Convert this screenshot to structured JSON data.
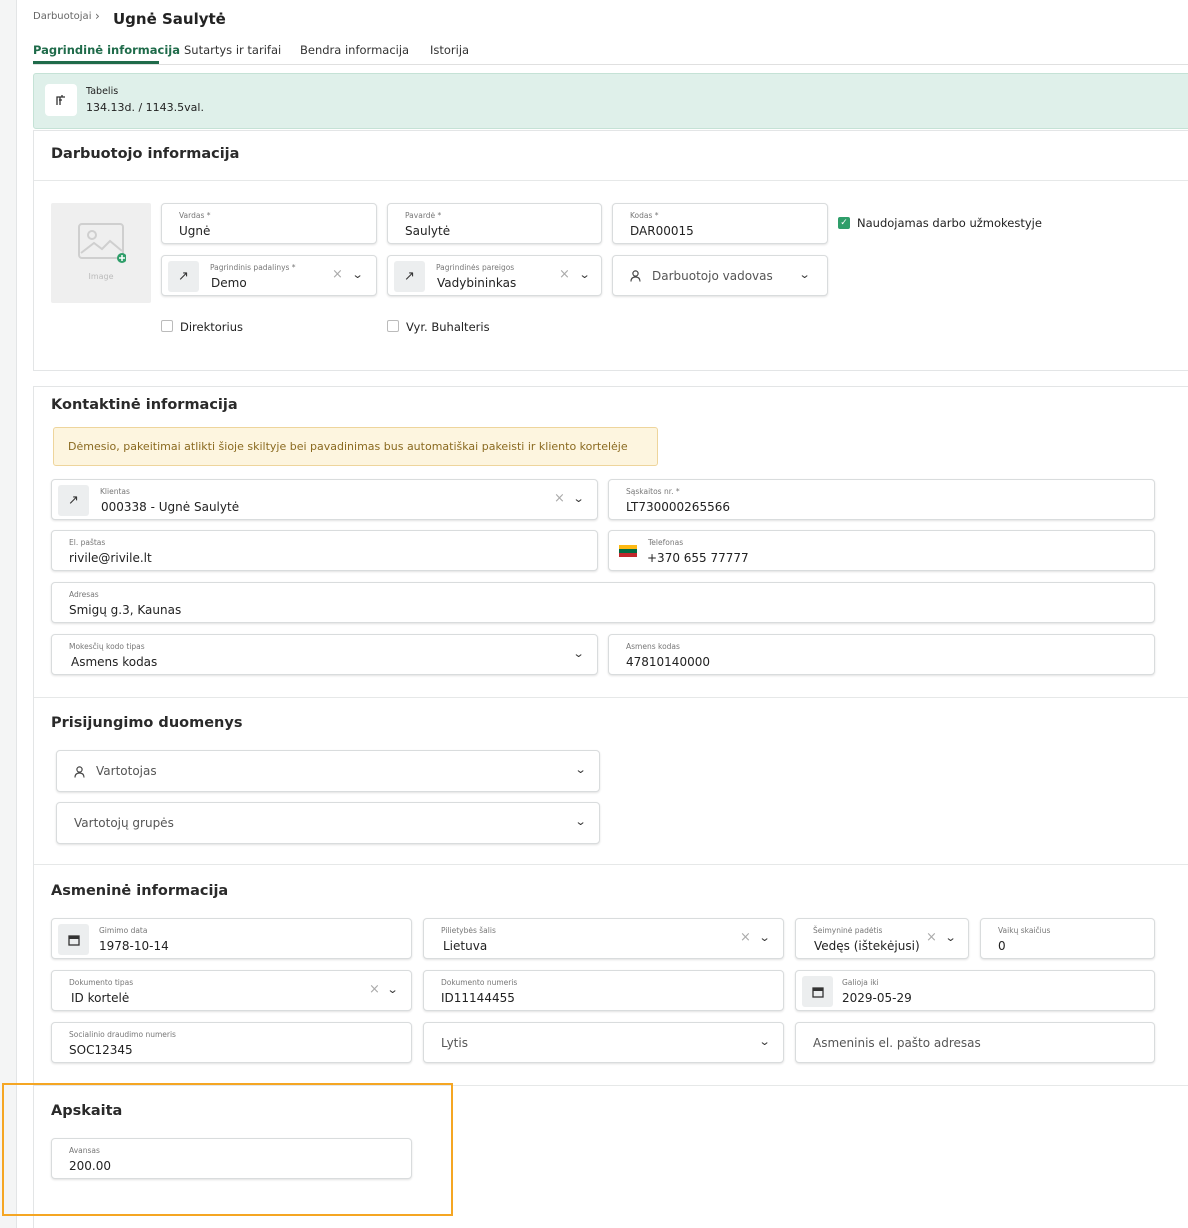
{
  "breadcrumb": {
    "root": "Darbuotojai",
    "current": "Ugnė Saulytė"
  },
  "tabs": [
    {
      "label": "Pagrindinė informacija",
      "active": true
    },
    {
      "label": "Sutartys ir tarifai"
    },
    {
      "label": "Bendra informacija"
    },
    {
      "label": "Istorija"
    }
  ],
  "tabelis": {
    "title": "Tabelis",
    "value": "134.13d. / 1143.5val."
  },
  "employee": {
    "title": "Darbuotojo informacija",
    "image_label": "Image",
    "vardas": {
      "label": "Vardas *",
      "value": "Ugnė"
    },
    "pavarde": {
      "label": "Pavardė *",
      "value": "Saulytė"
    },
    "kodas": {
      "label": "Kodas *",
      "value": "DAR00015"
    },
    "payroll_checkbox": {
      "label": "Naudojamas darbo užmokestyje",
      "checked": true
    },
    "padalinys": {
      "label": "Pagrindinis padalinys *",
      "value": "Demo"
    },
    "pareigos": {
      "label": "Pagrindinės pareigos",
      "value": "Vadybininkas"
    },
    "vadovas": {
      "placeholder": "Darbuotojo vadovas"
    },
    "direktorius": {
      "label": "Direktorius",
      "checked": false
    },
    "buhalteris": {
      "label": "Vyr. Buhalteris",
      "checked": false
    }
  },
  "contact": {
    "title": "Kontaktinė informacija",
    "warning": "Dėmesio, pakeitimai atlikti šioje skiltyje bei pavadinimas bus automatiškai pakeisti ir kliento kortelėje",
    "klientas": {
      "label": "Klientas",
      "value": "000338 - Ugnė Saulytė"
    },
    "saskaita": {
      "label": "Sąskaitos nr. *",
      "value": "LT730000265566"
    },
    "pastas": {
      "label": "El. paštas",
      "value": "rivile@rivile.lt"
    },
    "telefonas": {
      "label": "Telefonas",
      "value": "+370 655 77777"
    },
    "adresas": {
      "label": "Adresas",
      "value": "Smigų g.3, Kaunas"
    },
    "mokesciu_tipas": {
      "label": "Mokesčių kodo tipas",
      "value": "Asmens kodas"
    },
    "asmens_kodas": {
      "label": "Asmens kodas",
      "value": "47810140000"
    }
  },
  "login": {
    "title": "Prisijungimo duomenys",
    "vartotojas": {
      "placeholder": "Vartotojas"
    },
    "grupes": {
      "placeholder": "Vartotojų grupės"
    }
  },
  "personal": {
    "title": "Asmeninė informacija",
    "gimimo_data": {
      "label": "Gimimo data",
      "value": "1978-10-14"
    },
    "pilietybe": {
      "label": "Pilietybės šalis",
      "value": "Lietuva"
    },
    "seimynine": {
      "label": "Šeimyninė padėtis",
      "value": "Vedęs (ištekėjusi)"
    },
    "vaikai": {
      "label": "Vaikų skaičius",
      "value": "0"
    },
    "dok_tipas": {
      "label": "Dokumento tipas",
      "value": "ID kortelė"
    },
    "dok_numeris": {
      "label": "Dokumento numeris",
      "value": "ID11144455"
    },
    "galioja": {
      "label": "Galioja iki",
      "value": "2029-05-29"
    },
    "socialinio": {
      "label": "Socialinio draudimo numeris",
      "value": "SOC12345"
    },
    "lytis": {
      "placeholder": "Lytis"
    },
    "el_pastas": {
      "placeholder": "Asmeninis el. pašto adresas"
    }
  },
  "apskaita": {
    "title": "Apskaita",
    "avansas": {
      "label": "Avansas",
      "value": "200.00"
    }
  },
  "colors": {
    "accent": "#1f6b4a",
    "banner": "#dff0ea",
    "warning_bg": "#fdf5df",
    "highlight": "#f5a623"
  }
}
